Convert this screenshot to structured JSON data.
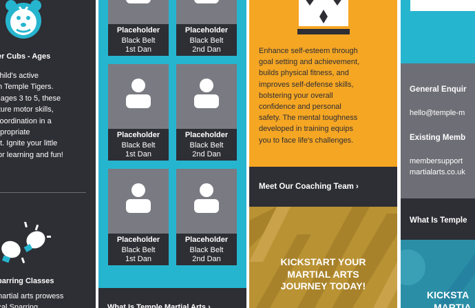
{
  "col1": {
    "section1_title": "er Cubs - Ages",
    "section1_text": "child's active\nth Temple Tigers.\nr ages 3 to 5, these\nrture motor skills,\ncoordination in a\nopropriate\nnt. Ignite your little\nfor learning and fun!",
    "section2_title": "parring Classes",
    "section2_text": "martial arts prowess\nical Sparring"
  },
  "col2": {
    "cards": [
      {
        "name": "Placeholder",
        "rank": "Black Belt",
        "dan": "1st Dan"
      },
      {
        "name": "Placeholder",
        "rank": "Black Belt",
        "dan": "2nd Dan"
      },
      {
        "name": "Placeholder",
        "rank": "Black Belt",
        "dan": "1st Dan"
      },
      {
        "name": "Placeholder",
        "rank": "Black Belt",
        "dan": "2nd Dan"
      },
      {
        "name": "Placeholder",
        "rank": "Black Belt",
        "dan": "1st Dan"
      },
      {
        "name": "Placeholder",
        "rank": "Black Belt",
        "dan": "2nd Dan"
      }
    ],
    "link_label": "What Is Temple Martial Arts ›"
  },
  "col3": {
    "paragraph": "Enhance self-esteem through\ngoal setting and achievement,\nbuilds physical fitness, and\nimproves self-defense skills,\nbolstering your overall\nconfidence and personal\nsafety. The mental toughness\ndeveloped in training equips\nyou to face life's challenges.",
    "cta_label": "Meet Our Coaching Team  ›",
    "banner_text": "KICKSTART YOUR\nMARTIAL ARTS\nJOURNEY TODAY!"
  },
  "col4": {
    "general_title": "General Enquir",
    "general_email": "hello@temple-m",
    "existing_title": "Existing Memb",
    "existing_email": "membersupport\nmartialarts.co.uk",
    "bar_label": "What Is Temple",
    "banner_text": "KICKSTA\nMARTIA"
  },
  "colors": {
    "dark": "#2e2e35",
    "teal": "#26b5cf",
    "orange": "#f5a623",
    "grey": "#6e6e76"
  }
}
